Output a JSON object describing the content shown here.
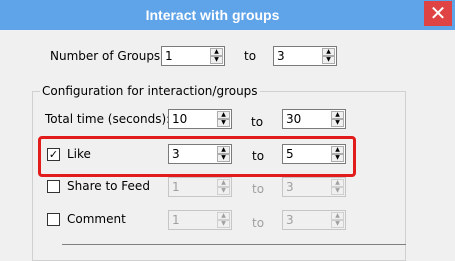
{
  "window": {
    "title": "Interact with groups",
    "close_glyph": "✕"
  },
  "number_of_groups": {
    "label": "Number of Groups:",
    "from": "1",
    "to_label": "to",
    "to": "3"
  },
  "config": {
    "title": "Configuration for interaction/groups",
    "total_time": {
      "label": "Total time (seconds):",
      "from": "10",
      "to_label": "to",
      "to": "30"
    },
    "like": {
      "label": "Like",
      "checked": true,
      "check_glyph": "✓",
      "from": "3",
      "to_label": "to",
      "to": "5"
    },
    "share_to_feed": {
      "label": "Share to Feed",
      "checked": false,
      "from": "1",
      "to_label": "to",
      "to": "3"
    },
    "comment": {
      "label": "Comment",
      "checked": false,
      "from": "1",
      "to_label": "to",
      "to": "3"
    }
  },
  "colors": {
    "titlebar": "#5fa3e8",
    "close_button": "#e04343",
    "highlight": "#e21b1b"
  },
  "icons": {
    "spin_up": "▲",
    "spin_down": "▼"
  }
}
